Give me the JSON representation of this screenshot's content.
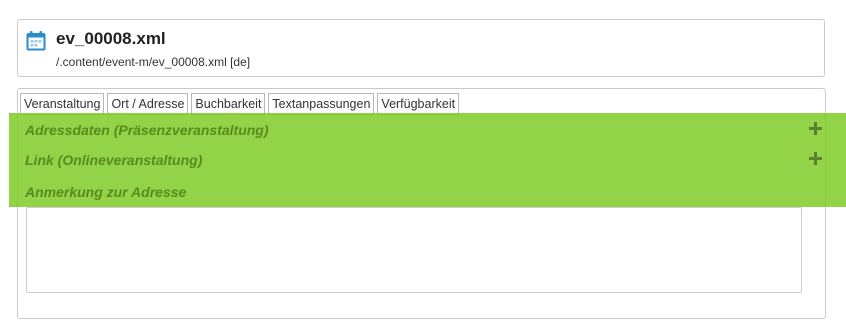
{
  "file": {
    "name": "ev_00008.xml",
    "path": "/.content/event-m/ev_00008.xml [de]",
    "icon": "calendar-icon"
  },
  "tabs": [
    {
      "label": "Veranstaltung"
    },
    {
      "label": "Ort / Adresse"
    },
    {
      "label": "Buchbarkeit"
    },
    {
      "label": "Textanpassungen"
    },
    {
      "label": "Verfügbarkeit"
    }
  ],
  "sections": [
    {
      "label": "Adressdaten (Präsenzveranstaltung)",
      "icon": "plus-icon"
    },
    {
      "label": "Link (Onlineveranstaltung)",
      "icon": "plus-icon"
    },
    {
      "label": "Anmerkung zur Adresse"
    }
  ],
  "colors": {
    "highlight": "#7ac91f",
    "section_text": "#5a8a1e",
    "icon_blue": "#2e8bc9"
  }
}
